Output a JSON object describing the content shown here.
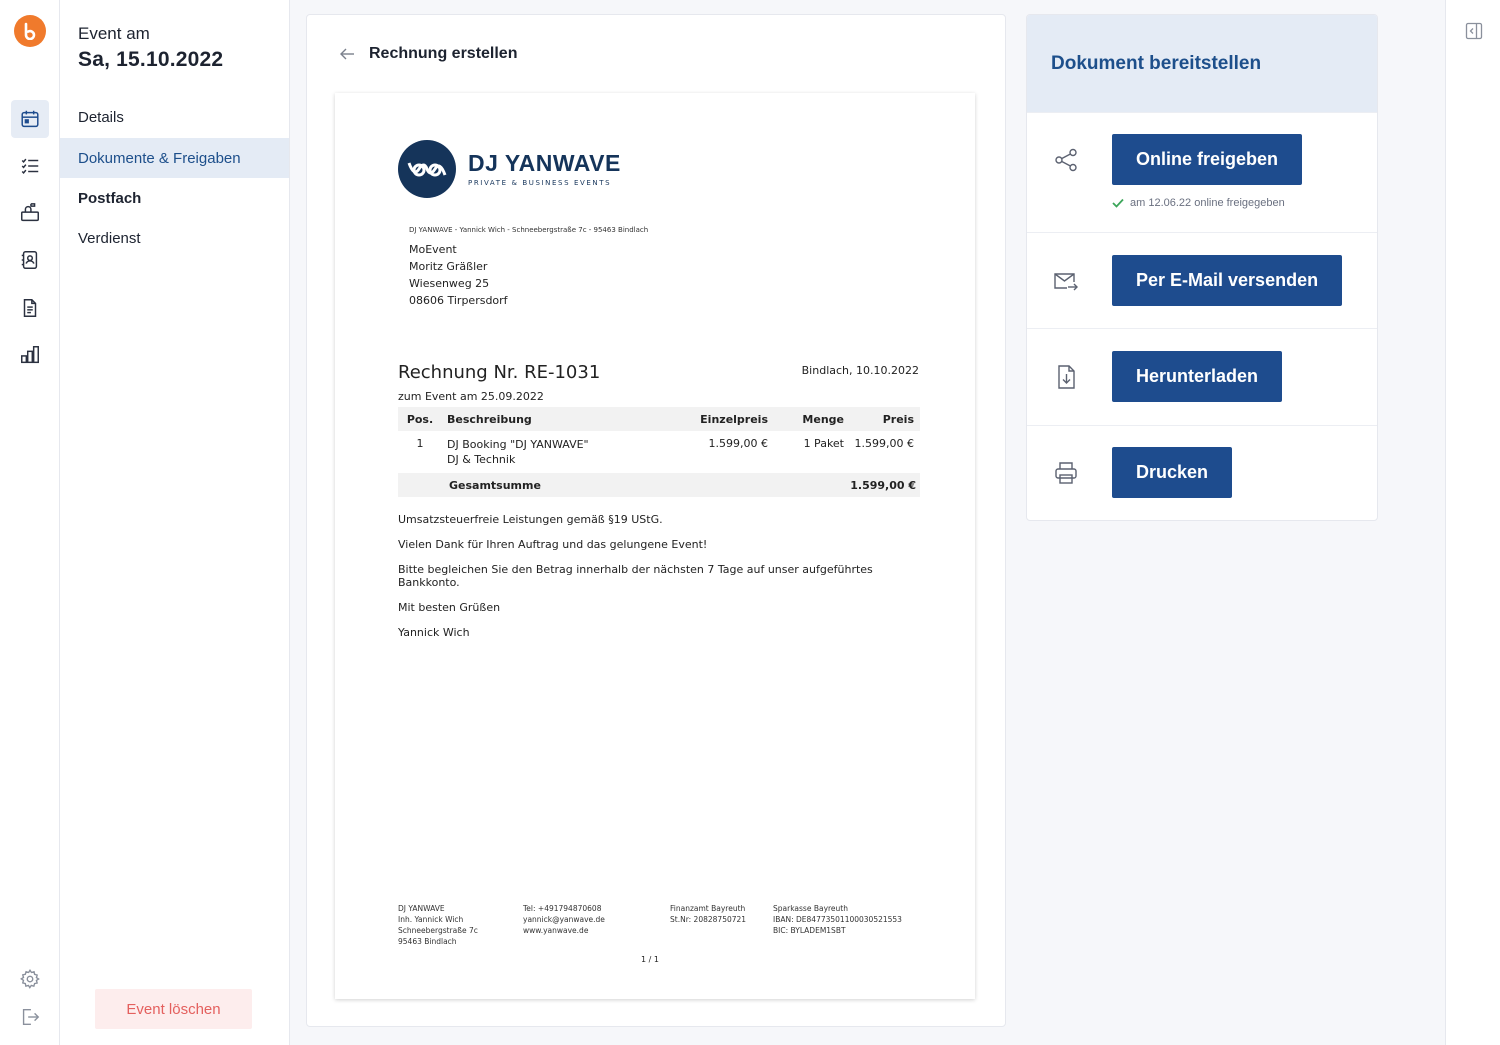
{
  "app": {
    "accent_color": "#1e4c8e",
    "logo_color": "#f07a2c"
  },
  "rail": {
    "items": [
      {
        "icon": "calendar-icon",
        "active": true
      },
      {
        "icon": "checklist-icon",
        "active": false
      },
      {
        "icon": "mailbox-icon",
        "active": false
      },
      {
        "icon": "contacts-icon",
        "active": false
      },
      {
        "icon": "document-icon",
        "active": false
      },
      {
        "icon": "bar-chart-icon",
        "active": false
      }
    ],
    "bottom": [
      {
        "icon": "gear-icon"
      },
      {
        "icon": "logout-icon"
      }
    ]
  },
  "event": {
    "label": "Event am",
    "date": "Sa, 15.10.2022",
    "nav": [
      {
        "label": "Details"
      },
      {
        "label": "Dokumente & Freigaben"
      },
      {
        "label": "Postfach"
      },
      {
        "label": "Verdienst"
      }
    ],
    "delete_label": "Event löschen"
  },
  "main": {
    "title": "Rechnung erstellen"
  },
  "invoice": {
    "brand_name": "DJ YANWAVE",
    "brand_tagline": "PRIVATE & BUSINESS EVENTS",
    "sender_line": "DJ YANWAVE - Yannick Wich - Schneebergstraße 7c - 95463 Bindlach",
    "recipient": [
      "MoEvent",
      "Moritz Gräßler",
      "Wiesenweg 25",
      "08606 Tirpersdorf"
    ],
    "title": "Rechnung Nr. RE-1031",
    "date": "Bindlach, 10.10.2022",
    "subtitle": "zum Event am 25.09.2022",
    "table": {
      "headers": {
        "pos": "Pos.",
        "desc": "Beschreibung",
        "unit": "Einzelpreis",
        "qty": "Menge",
        "price": "Preis"
      },
      "rows": [
        {
          "pos": "1",
          "desc": "DJ Booking \"DJ YANWAVE\"",
          "desc2": "DJ & Technik",
          "unit": "1.599,00 €",
          "qty": "1 Paket",
          "price": "1.599,00 €"
        }
      ],
      "sum_label": "Gesamtsumme",
      "sum_value": "1.599,00 €"
    },
    "texts": [
      "Umsatzsteuerfreie Leistungen gemäß §19 UStG.",
      "Vielen Dank für Ihren Auftrag und das gelungene Event!",
      "Bitte begleichen Sie den Betrag innerhalb der nächsten 7 Tage auf unser aufgeführtes Bankkonto.",
      "Mit besten Grüßen",
      "Yannick Wich"
    ],
    "footer": {
      "col1": [
        "DJ YANWAVE",
        "Inh. Yannick Wich",
        "Schneebergstraße 7c",
        "95463 Bindlach"
      ],
      "col2": [
        "Tel: +491794870608",
        "yannick@yanwave.de",
        "www.yanwave.de"
      ],
      "col3": [
        "Finanzamt Bayreuth",
        "St.Nr: 20828750721"
      ],
      "col4": [
        "Sparkasse Bayreuth",
        "IBAN: DE84773501100030521553",
        "BIC: BYLADEM1SBT"
      ]
    },
    "page": "1 / 1"
  },
  "share_panel": {
    "title": "Dokument bereitstellen",
    "actions": [
      {
        "icon": "share-icon",
        "label": "Online freigeben",
        "note": "am 12.06.22 online freigegeben"
      },
      {
        "icon": "mail-send-icon",
        "label": "Per E-Mail versenden"
      },
      {
        "icon": "download-file-icon",
        "label": "Herunterladen"
      },
      {
        "icon": "printer-icon",
        "label": "Drucken"
      }
    ]
  }
}
